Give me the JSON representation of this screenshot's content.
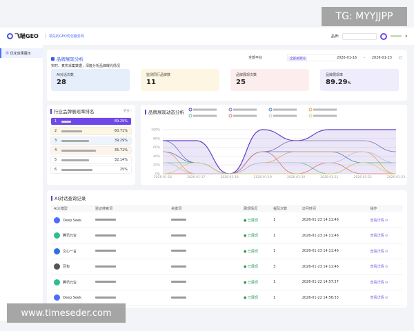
{
  "header": {
    "logo": "飞瞄GEO",
    "subtitle": "领先的GEO优化服务商",
    "brand_label": "品牌:"
  },
  "sidebar": {
    "items": [
      {
        "label": "优化效果展示"
      }
    ]
  },
  "overview": {
    "title": "品牌展现分析",
    "desc": "实时、真实采集数据，深度分析品牌曝光情况",
    "platform": "全部平台",
    "tag": "全部关键词",
    "date_start": "2026-01-16",
    "date_sep": "-",
    "date_end": "2026-01-23",
    "kpis": [
      {
        "label": "AI对话次数",
        "value": "28",
        "bg": "#e6eefc"
      },
      {
        "label": "监测同行品牌数",
        "value": "11",
        "bg": "#fdf6e3"
      },
      {
        "label": "品牌展现次数",
        "value": "25",
        "bg": "#fdeeee"
      },
      {
        "label": "品牌展现率",
        "value": "89.29",
        "unit": "%",
        "bg": "#efedfb"
      }
    ]
  },
  "ranking": {
    "title": "行业品牌展现率排名",
    "more": "更多 ›",
    "rows": [
      {
        "rank": "1",
        "pct": "89.29%"
      },
      {
        "rank": "2",
        "pct": "60.71%"
      },
      {
        "rank": "3",
        "pct": "39.29%"
      },
      {
        "rank": "4",
        "pct": "35.71%"
      },
      {
        "rank": "5",
        "pct": "32.14%"
      },
      {
        "rank": "6",
        "pct": "25%"
      }
    ]
  },
  "chart_data": {
    "type": "line",
    "title": "品牌展现动态分析",
    "categories": [
      "2026-01-16",
      "2026-01-17",
      "2026-01-18",
      "2026-01-19",
      "2026-01-20",
      "2026-01-21",
      "2026-01-22",
      "2026-01-23"
    ],
    "yticks": [
      "0%",
      "20%",
      "40%",
      "60%",
      "80%",
      "100%"
    ],
    "ylim": [
      0,
      100
    ],
    "legend": "top",
    "series": [
      {
        "color": "#5f3dc4",
        "values": [
          75,
          75,
          0,
          100,
          75,
          100,
          100,
          100
        ],
        "fill": true
      },
      {
        "color": "#7b6fb0",
        "values": [
          75,
          25,
          0,
          50,
          75,
          75,
          75,
          50
        ]
      },
      {
        "color": "#4c7fc9",
        "values": [
          50,
          25,
          0,
          50,
          50,
          50,
          25,
          25
        ]
      },
      {
        "color": "#e8a05a",
        "values": [
          50,
          0,
          0,
          25,
          50,
          50,
          50,
          0
        ]
      },
      {
        "color": "#6cc08b",
        "values": [
          25,
          25,
          0,
          25,
          25,
          0,
          25,
          25
        ]
      },
      {
        "color": "#d9776f",
        "values": [
          0,
          0,
          0,
          50,
          0,
          25,
          0,
          0
        ]
      },
      {
        "color": "#bdbdd6",
        "values": [
          25,
          0,
          0,
          25,
          25,
          25,
          50,
          25
        ]
      },
      {
        "color": "#d6cf6a",
        "values": [
          0,
          25,
          0,
          0,
          0,
          0,
          25,
          0
        ]
      }
    ]
  },
  "records": {
    "title": "AI对话查询记录",
    "columns": [
      "AI大模型",
      "验证搜索词",
      "关键词",
      "展现情况",
      "提及次数",
      "访问时间",
      "操作"
    ],
    "rows": [
      {
        "model": "Deep Seek",
        "color": "#4d6bfe",
        "status": "● 已展现",
        "count": "1",
        "time": "2026-01-23 14:11:46",
        "action": "查看详情 ⊙"
      },
      {
        "model": "腾讯元宝",
        "color": "#2bbf8a",
        "status": "● 已展现",
        "count": "1",
        "time": "2026-01-23 14:11:46",
        "action": "查看详情 ⊙"
      },
      {
        "model": "文心一言",
        "color": "#2f6fe0",
        "status": "● 已展现",
        "count": "1",
        "time": "2026-01-23 14:11:46",
        "action": "查看详情 ⊙"
      },
      {
        "model": "豆包",
        "color": "#555",
        "status": "● 已展现",
        "count": "3",
        "time": "2026-01-23 14:11:46",
        "action": "查看详情 ⊙"
      },
      {
        "model": "腾讯元宝",
        "color": "#2bbf8a",
        "status": "● 已展现",
        "count": "1",
        "time": "2026-01-22 14:57:37",
        "action": "查看详情 ⊙"
      },
      {
        "model": "Deep Seek",
        "color": "#4d6bfe",
        "status": "● 已展现",
        "count": "1",
        "time": "2026-01-22 14:56:33",
        "action": "查看详情 ⊙"
      }
    ]
  },
  "watermarks": {
    "tg": "TG: MYYJJPP",
    "site": "www.timeseder.com"
  }
}
